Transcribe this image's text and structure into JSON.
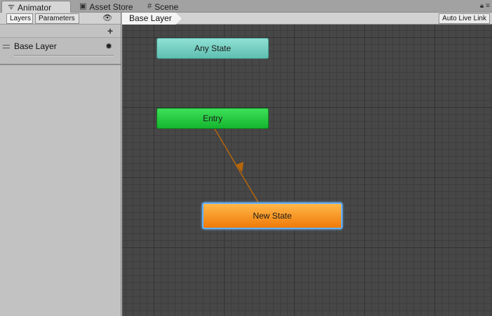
{
  "window_tabs": [
    {
      "label": "Animator",
      "icon": "animator-icon"
    },
    {
      "label": "Asset Store",
      "icon": "store-icon"
    },
    {
      "label": "Scene",
      "icon": "scene-grid-icon"
    }
  ],
  "left_panel": {
    "tabs": [
      {
        "label": "Layers"
      },
      {
        "label": "Parameters"
      }
    ],
    "layers": [
      {
        "name": "Base Layer"
      }
    ]
  },
  "graph": {
    "breadcrumb": "Base Layer",
    "auto_live_link": "Auto Live Link",
    "states": {
      "any_state": "Any State",
      "entry": "Entry",
      "new_state": "New State"
    }
  },
  "colors": {
    "any_state": "#6fd0c3",
    "entry": "#22c83c",
    "new_state": "#f7931e",
    "selection": "#5fb1ff",
    "transition": "#b5650b"
  }
}
